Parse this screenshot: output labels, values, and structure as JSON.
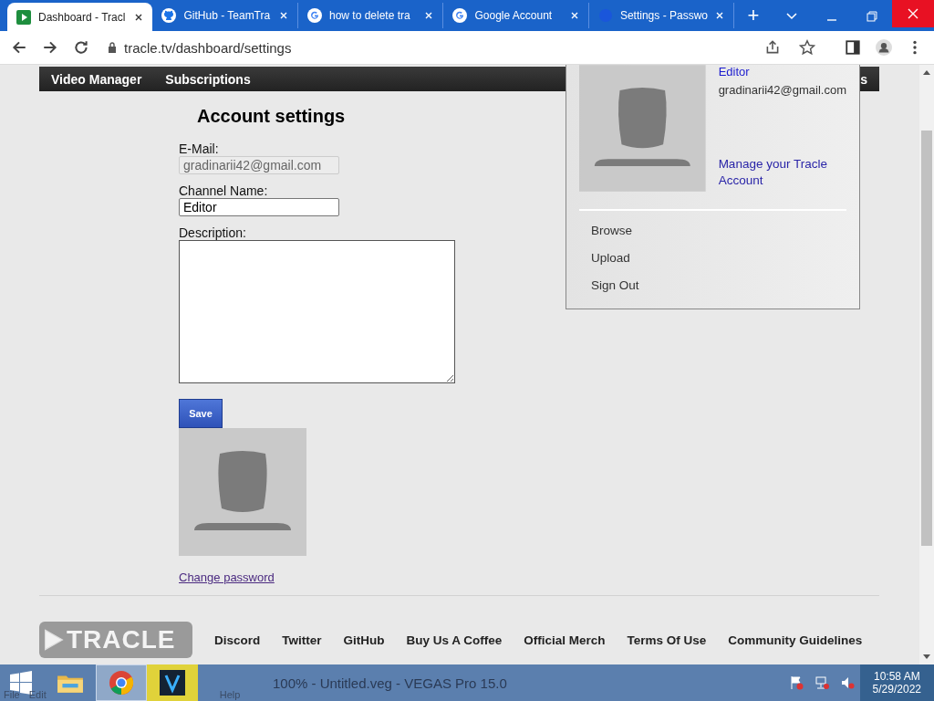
{
  "browser": {
    "tabs": [
      {
        "title": "Dashboard - Tracl",
        "kind": "play",
        "selected": true
      },
      {
        "title": "GitHub - TeamTra",
        "kind": "github",
        "selected": false
      },
      {
        "title": "how to delete tra",
        "kind": "google",
        "selected": false
      },
      {
        "title": "Google Account",
        "kind": "google",
        "selected": false
      },
      {
        "title": "Settings - Passwo",
        "kind": "globe",
        "selected": false
      }
    ],
    "new_tab": "+",
    "url": "tracle.tv/dashboard/settings"
  },
  "nav": {
    "items": [
      "Video Manager",
      "Subscriptions"
    ],
    "right_fragment": "s"
  },
  "page": {
    "title": "Account settings",
    "fields": [
      {
        "label": "E-Mail:",
        "value": "gradinarii42@gmail.com",
        "kind": "input",
        "disabled": true
      },
      {
        "label": "Channel Name:",
        "value": "Editor",
        "kind": "input",
        "disabled": false
      },
      {
        "label": "Description:",
        "kind": "textarea"
      }
    ],
    "save_button": "Save",
    "change_password": "Change password"
  },
  "account_menu": {
    "name": "Editor",
    "email": "gradinarii42@gmail.com",
    "manage_link": "Manage your Tracle Account",
    "items": [
      "Browse",
      "Upload",
      "Sign Out"
    ]
  },
  "footer": {
    "logo": "TRACLE",
    "links": [
      "Discord",
      "Twitter",
      "GitHub",
      "Buy Us A Coffee",
      "Official Merch",
      "Terms Of Use",
      "Community Guidelines"
    ]
  },
  "taskbar": {
    "window_title": "100% - Untitled.veg - VEGAS Pro 15.0",
    "menu": [
      "File",
      "Edit",
      "Help"
    ],
    "time": "10:58 AM",
    "date": "5/29/2022"
  }
}
